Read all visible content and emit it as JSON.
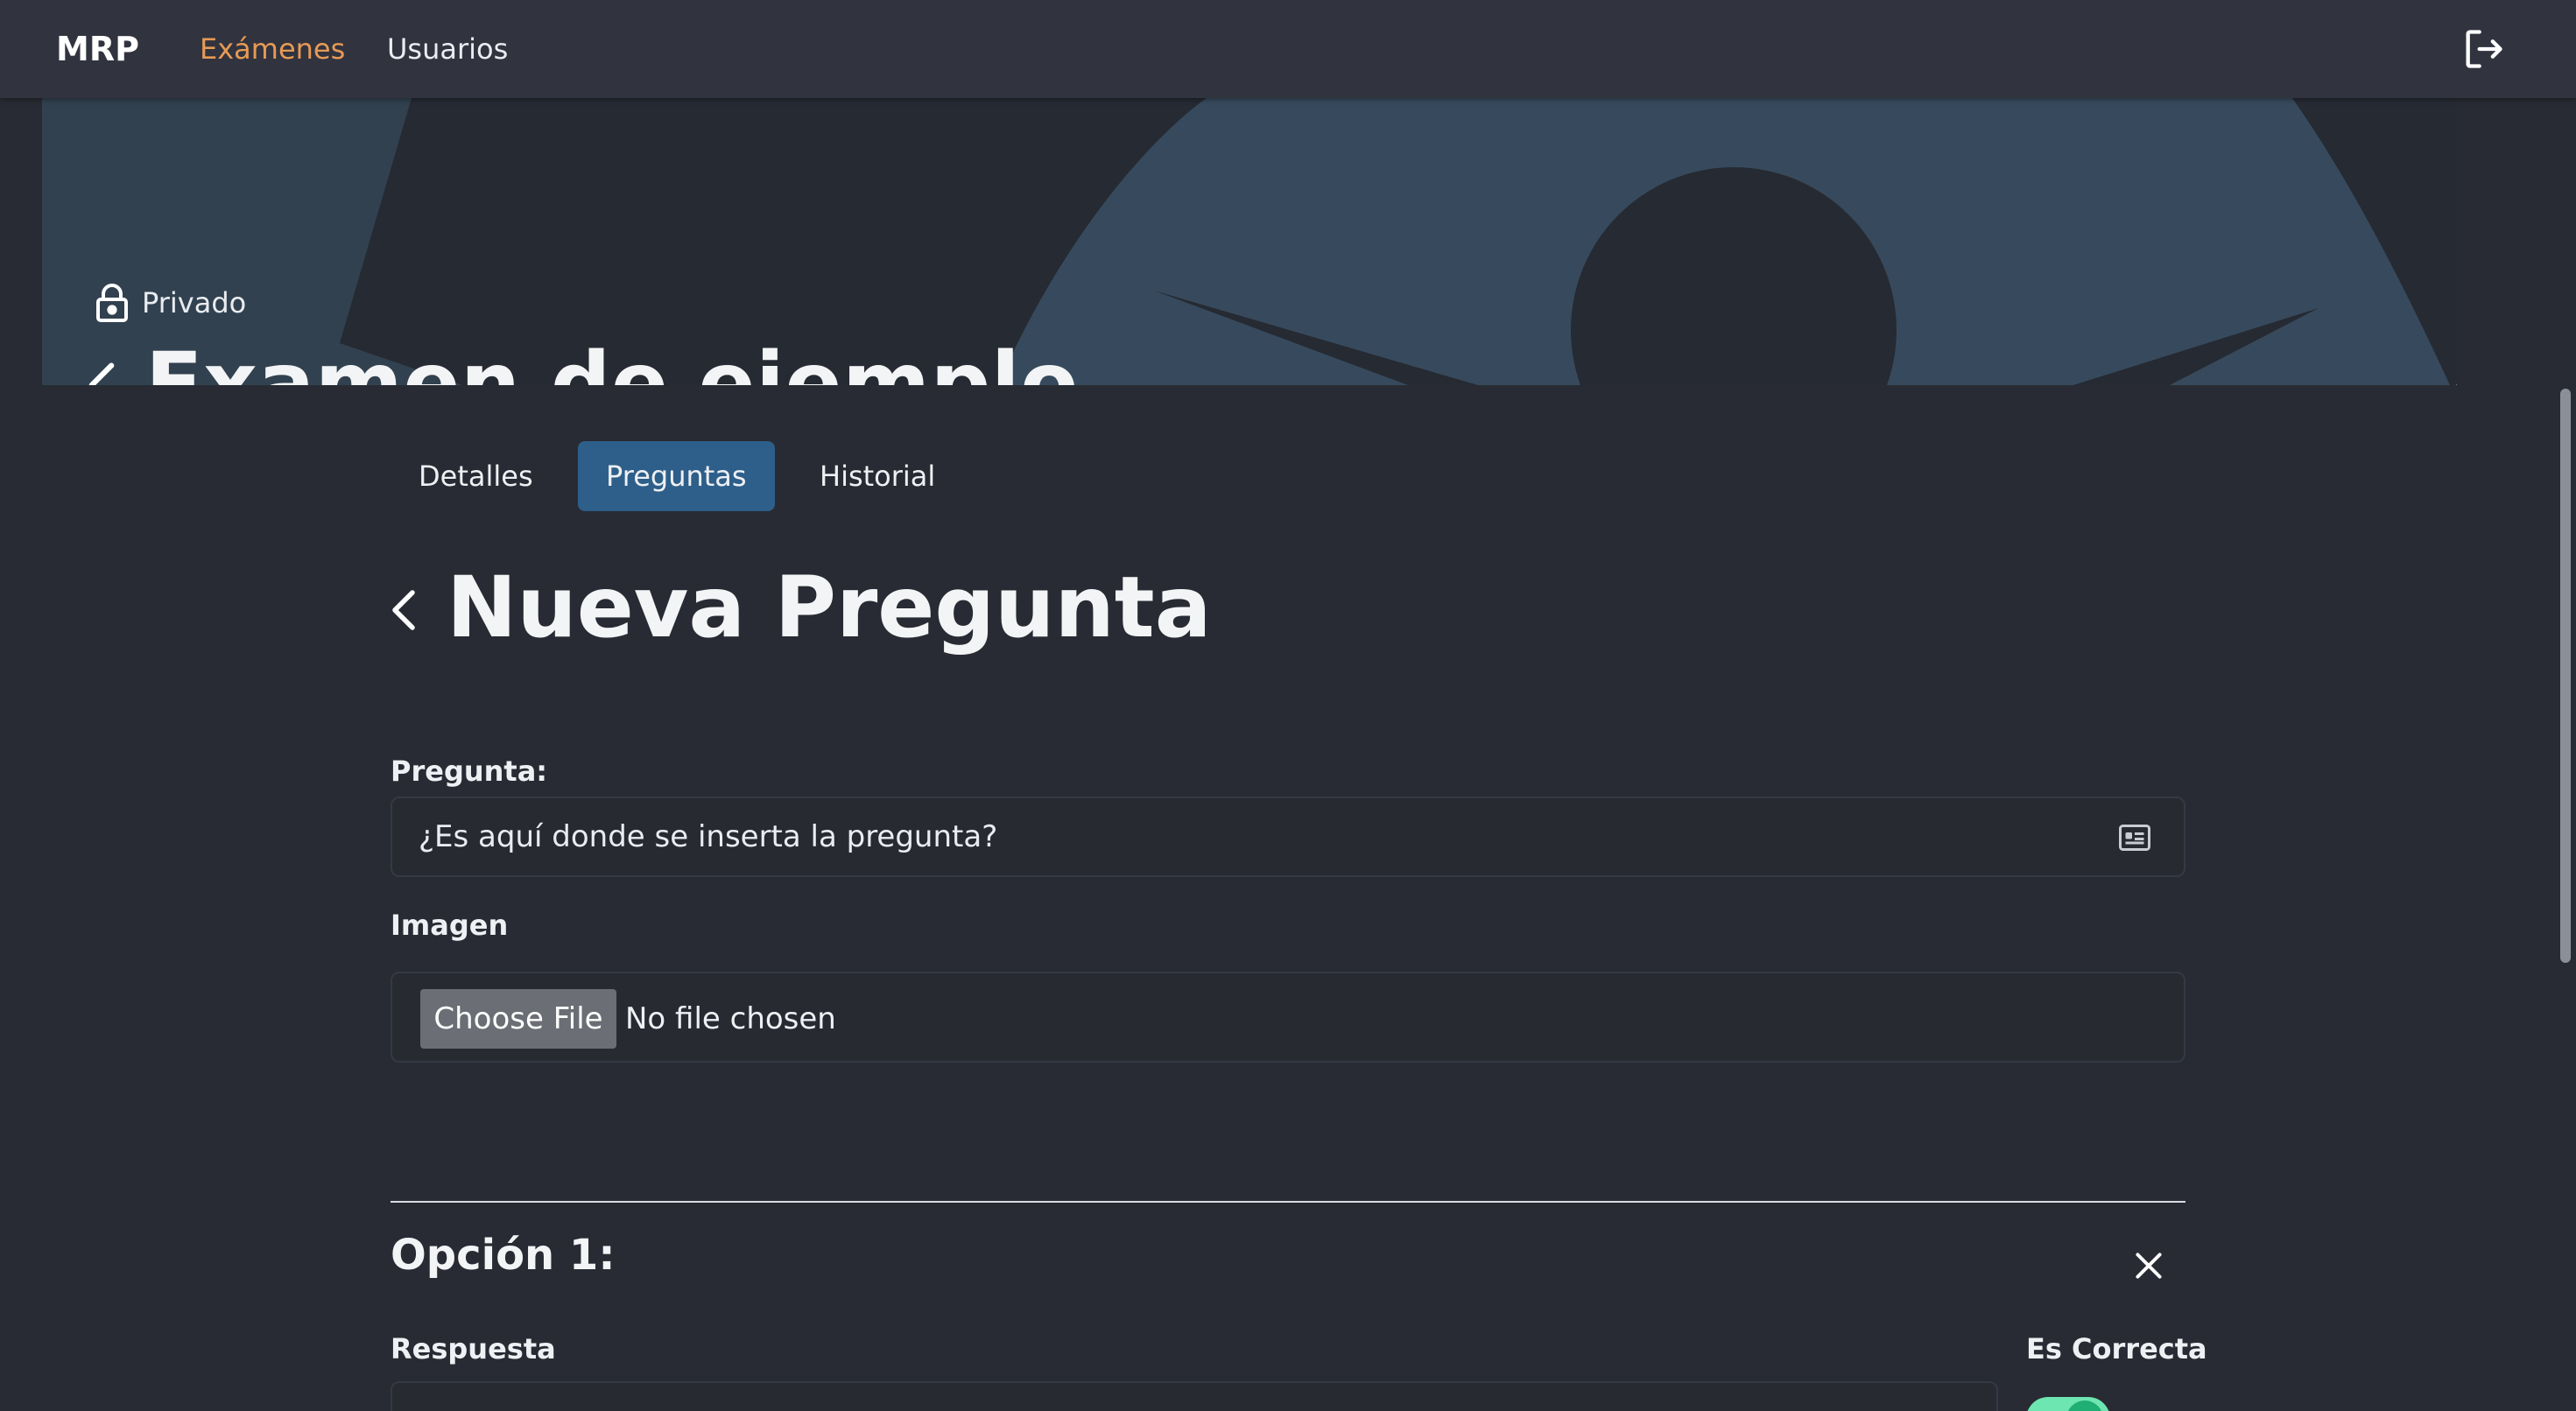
{
  "nav": {
    "brand": "MRP",
    "links": [
      {
        "label": "Exámenes",
        "active": true
      },
      {
        "label": "Usuarios",
        "active": false
      }
    ],
    "logout_icon": "logout-icon"
  },
  "exam": {
    "visibility": "Privado",
    "title": "Examen de ejemplo"
  },
  "tabs": [
    {
      "label": "Detalles",
      "active": false
    },
    {
      "label": "Preguntas",
      "active": true
    },
    {
      "label": "Historial",
      "active": false
    }
  ],
  "question_form": {
    "title": "Nueva Pregunta",
    "question_label": "Pregunta:",
    "question_value": "¿Es aquí donde se inserta la pregunta?",
    "image_label": "Imagen",
    "choose_file_label": "Choose File",
    "file_status": "No file chosen"
  },
  "option": {
    "title": "Opción 1:",
    "answer_label": "Respuesta",
    "correct_label": "Es Correcta",
    "correct_on": true
  },
  "colors": {
    "accent_orange": "#e69a55",
    "tab_active": "#2e5f8a",
    "toggle_on": "#1fae73"
  }
}
